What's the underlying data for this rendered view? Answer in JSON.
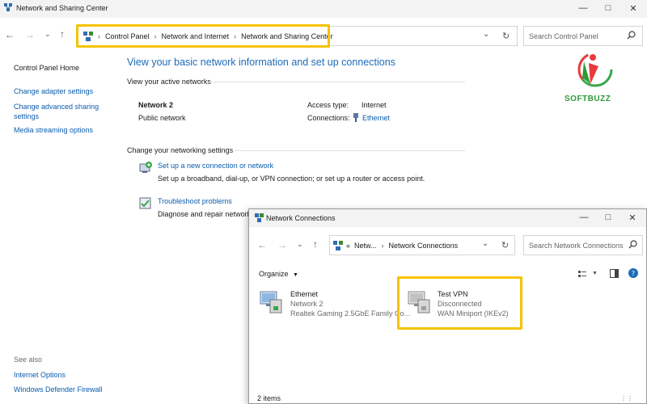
{
  "main_window": {
    "title": "Network and Sharing Center",
    "breadcrumb": [
      "Control Panel",
      "Network and Internet",
      "Network and Sharing Center"
    ],
    "search_placeholder": "Search Control Panel",
    "sidebar": {
      "items": [
        "Control Panel Home",
        "Change adapter settings",
        "Change advanced sharing settings",
        "Media streaming options"
      ],
      "see_also_label": "See also",
      "see_also": [
        "Internet Options",
        "Windows Defender Firewall"
      ]
    },
    "heading": "View your basic network information and set up connections",
    "active_networks_label": "View your active networks",
    "network": {
      "name": "Network 2",
      "type": "Public network",
      "access_type_label": "Access type:",
      "access_type_value": "Internet",
      "connections_label": "Connections:",
      "connections_value": "Ethernet"
    },
    "change_settings_label": "Change your networking settings",
    "tasks": [
      {
        "title": "Set up a new connection or network",
        "desc": "Set up a broadband, dial-up, or VPN connection; or set up a router or access point."
      },
      {
        "title": "Troubleshoot problems",
        "desc": "Diagnose and repair network p"
      }
    ]
  },
  "logo_text": "SOFTBUZZ",
  "nc_window": {
    "title": "Network Connections",
    "breadcrumb": [
      "Netw...",
      "Network Connections"
    ],
    "search_placeholder": "Search Network Connections",
    "organize_label": "Organize",
    "items": [
      {
        "name": "Ethernet",
        "line2": "Network 2",
        "line3": "Realtek Gaming 2.5GbE Family Co..."
      },
      {
        "name": "Test VPN",
        "line2": "Disconnected",
        "line3": "WAN Miniport (IKEv2)"
      }
    ],
    "status": "2 items"
  },
  "colors": {
    "accent_link": "#0b5cad",
    "heading_blue": "#1e6cb8",
    "highlight": "#f6c300"
  }
}
